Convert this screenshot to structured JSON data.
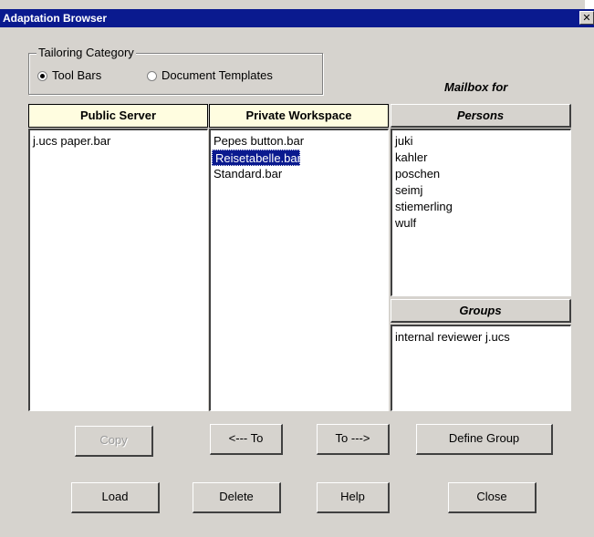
{
  "window": {
    "title": "Adaptation Browser",
    "close_glyph": "✕"
  },
  "tailoring": {
    "title": "Tailoring Category",
    "options": [
      {
        "label": "Tool Bars",
        "selected": true
      },
      {
        "label": "Document Templates",
        "selected": false
      }
    ]
  },
  "mailbox_label": "Mailbox for",
  "public_server": {
    "header": "Public Server",
    "items": [
      "j.ucs paper.bar"
    ]
  },
  "private_workspace": {
    "header": "Private Workspace",
    "items": [
      "Pepes button.bar",
      "Reisetabelle.bar",
      "Standard.bar"
    ],
    "selected": "Reisetabelle.bar"
  },
  "persons": {
    "header": "Persons",
    "items": [
      "juki",
      "kahler",
      "poschen",
      "seimj",
      "stiemerling",
      "wulf"
    ]
  },
  "groups": {
    "header": "Groups",
    "items": [
      "internal reviewer j.ucs"
    ]
  },
  "buttons": {
    "copy": "Copy",
    "to_left": "<--- To",
    "to_right": "To --->",
    "define_group": "Define Group",
    "load": "Load",
    "delete": "Delete",
    "help": "Help",
    "close": "Close"
  },
  "colors": {
    "titlebar": "#0a1a8f",
    "window_bg": "#d6d3ce",
    "selection": "#0a1a8f",
    "header_yellow": "#fffde0"
  }
}
